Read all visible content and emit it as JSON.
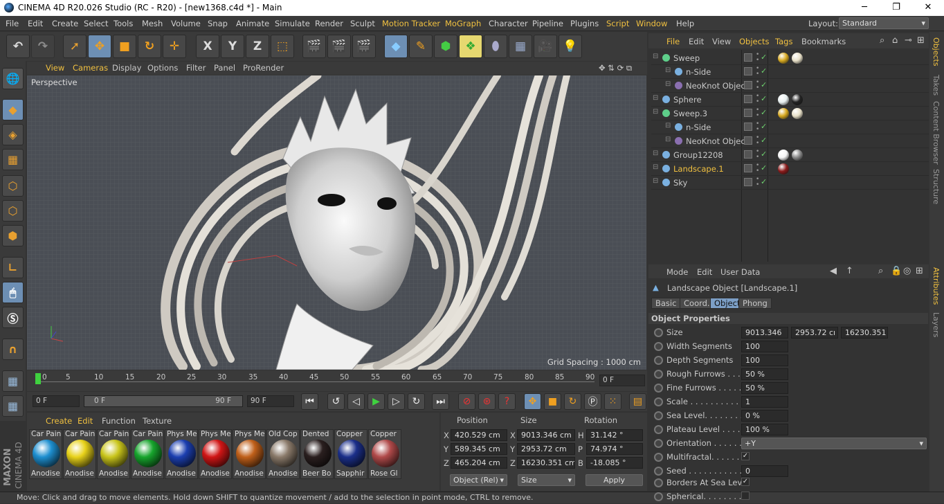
{
  "window": {
    "title": "CINEMA 4D R20.026 Studio (RC - R20) - [new1368.c4d *] - Main",
    "minimize": "─",
    "maximize": "❐",
    "close": "✕"
  },
  "menu": {
    "items": [
      "File",
      "Edit",
      "Create",
      "Select",
      "Tools",
      "Mesh",
      "Volume",
      "Snap",
      "Animate",
      "Simulate",
      "Render",
      "Sculpt",
      "Motion Tracker",
      "MoGraph",
      "Character",
      "Pipeline",
      "Plugins",
      "Script",
      "Window",
      "Help"
    ],
    "layout_label": "Layout:",
    "layout_value": "Standard"
  },
  "toolbar": {
    "x": "X",
    "y": "Y",
    "z": "Z"
  },
  "viewport": {
    "menu": [
      "View",
      "Cameras",
      "Display",
      "Options",
      "Filter",
      "Panel",
      "ProRender"
    ],
    "label": "Perspective",
    "grid_spacing": "Grid Spacing : 1000 cm"
  },
  "timeline": {
    "ticks": [
      "0",
      "5",
      "10",
      "15",
      "20",
      "25",
      "30",
      "35",
      "40",
      "45",
      "50",
      "55",
      "60",
      "65",
      "70",
      "75",
      "80",
      "85",
      "90"
    ],
    "current": "0 F",
    "start": "0 F",
    "range_start": "0 F",
    "range_end": "90 F",
    "end": "90 F"
  },
  "materials": {
    "menu": [
      "Create",
      "Edit",
      "Function",
      "Texture"
    ],
    "items": [
      {
        "name": "Car Pain",
        "label": "Anodise",
        "color": "#1e8fd0"
      },
      {
        "name": "Car Pain",
        "label": "Anodise",
        "color": "#e8d21a"
      },
      {
        "name": "Car Pain",
        "label": "Anodise",
        "color": "#c9c51b"
      },
      {
        "name": "Car Pain",
        "label": "Anodise",
        "color": "#17a52d"
      },
      {
        "name": "Phys Me",
        "label": "Anodise",
        "color": "#1c3fb0"
      },
      {
        "name": "Phys Me",
        "label": "Anodise",
        "color": "#d01616"
      },
      {
        "name": "Phys Me",
        "label": "Anodise",
        "color": "#c0601a"
      },
      {
        "name": "Old Cop",
        "label": "Anodise",
        "color": "#8a7a6a"
      },
      {
        "name": "Dented",
        "label": "Beer Bo",
        "color": "#2a1f1f"
      },
      {
        "name": "Copper",
        "label": "Sapphir",
        "color": "#1b2f8a"
      },
      {
        "name": "Copper",
        "label": "Rose Gl",
        "color": "#b04a4a"
      }
    ]
  },
  "coords": {
    "headers": [
      "Position",
      "Size",
      "Rotation"
    ],
    "rows": [
      {
        "axis": "X",
        "pos": "420.529 cm",
        "saxis": "X",
        "size": "9013.346 cm",
        "raxis": "H",
        "rot": "31.142 °"
      },
      {
        "axis": "Y",
        "pos": "589.345 cm",
        "saxis": "Y",
        "size": "2953.72 cm",
        "raxis": "P",
        "rot": "74.974 °"
      },
      {
        "axis": "Z",
        "pos": "465.204 cm",
        "saxis": "Z",
        "size": "16230.351 cm",
        "raxis": "B",
        "rot": "-18.085 °"
      }
    ],
    "mode": "Object (Rel)",
    "size_mode": "Size",
    "apply": "Apply"
  },
  "status": "Move: Click and drag to move elements. Hold down SHIFT to quantize movement / add to the selection in point mode, CTRL to remove.",
  "objects": {
    "menu": [
      "File",
      "Edit",
      "View",
      "Objects",
      "Tags",
      "Bookmarks"
    ],
    "items": [
      {
        "name": "Sweep",
        "indent": 0,
        "color": "#5ecf8a",
        "tags": [
          "#d6a820",
          "#e8e0c8"
        ]
      },
      {
        "name": "n-Side",
        "indent": 1,
        "color": "#7ab0e0",
        "tags": []
      },
      {
        "name": "NeoKnot Object",
        "indent": 1,
        "color": "#8a6fb0",
        "tags": []
      },
      {
        "name": "Sphere",
        "indent": 0,
        "color": "#7ab0e0",
        "tags": [
          "#e8f0f0",
          "#222"
        ]
      },
      {
        "name": "Sweep.3",
        "indent": 0,
        "color": "#5ecf8a",
        "tags": [
          "#d6a820",
          "#e8e0c8"
        ]
      },
      {
        "name": "n-Side",
        "indent": 1,
        "color": "#7ab0e0",
        "tags": []
      },
      {
        "name": "NeoKnot Object",
        "indent": 1,
        "color": "#8a6fb0",
        "tags": []
      },
      {
        "name": "Group12208",
        "indent": 0,
        "color": "#7ab0e0",
        "tags": [
          "#f4f4f4",
          "#888"
        ]
      },
      {
        "name": "Landscape.1",
        "indent": 0,
        "color": "#7ab0e0",
        "tags": [
          "#8a1a1a"
        ]
      },
      {
        "name": "Sky",
        "indent": 0,
        "color": "#7ab0e0",
        "tags": []
      }
    ]
  },
  "attributes": {
    "menu": [
      "Mode",
      "Edit",
      "User Data"
    ],
    "object_title": "Landscape Object [Landscape.1]",
    "tabs": [
      "Basic",
      "Coord.",
      "Object",
      "Phong"
    ],
    "section": "Object Properties",
    "size": [
      "9013.346",
      "2953.72 cı",
      "16230.351"
    ],
    "props": [
      {
        "label": "Size",
        "value": ""
      },
      {
        "label": "Width Segments",
        "value": "100"
      },
      {
        "label": "Depth Segments",
        "value": "100"
      },
      {
        "label": "Rough Furrows . . .",
        "value": "50 %"
      },
      {
        "label": "Fine Furrows . . . . .",
        "value": "50 %"
      },
      {
        "label": "Scale . . . . . . . . . . . .",
        "value": "1"
      },
      {
        "label": "Sea Level. . . . . . . . .",
        "value": "0 %"
      },
      {
        "label": "Plateau Level . . . . .",
        "value": "100 %"
      },
      {
        "label": "Orientation . . . . . . .",
        "value": "+Y"
      },
      {
        "label": "Multifractal. . . . . . .",
        "value": "✓"
      },
      {
        "label": "Seed . . . . . . . . . . . .",
        "value": "0"
      },
      {
        "label": "Borders At Sea Level",
        "value": "✓"
      },
      {
        "label": "Spherical. . . . . . . . .",
        "value": ""
      }
    ]
  },
  "side_tabs": [
    "Objects",
    "Takes",
    "Content Browser",
    "Structure",
    "Attributes",
    "Layers"
  ],
  "branding": {
    "maxon": "MAXON",
    "cinema": "CINEMA 4D"
  }
}
